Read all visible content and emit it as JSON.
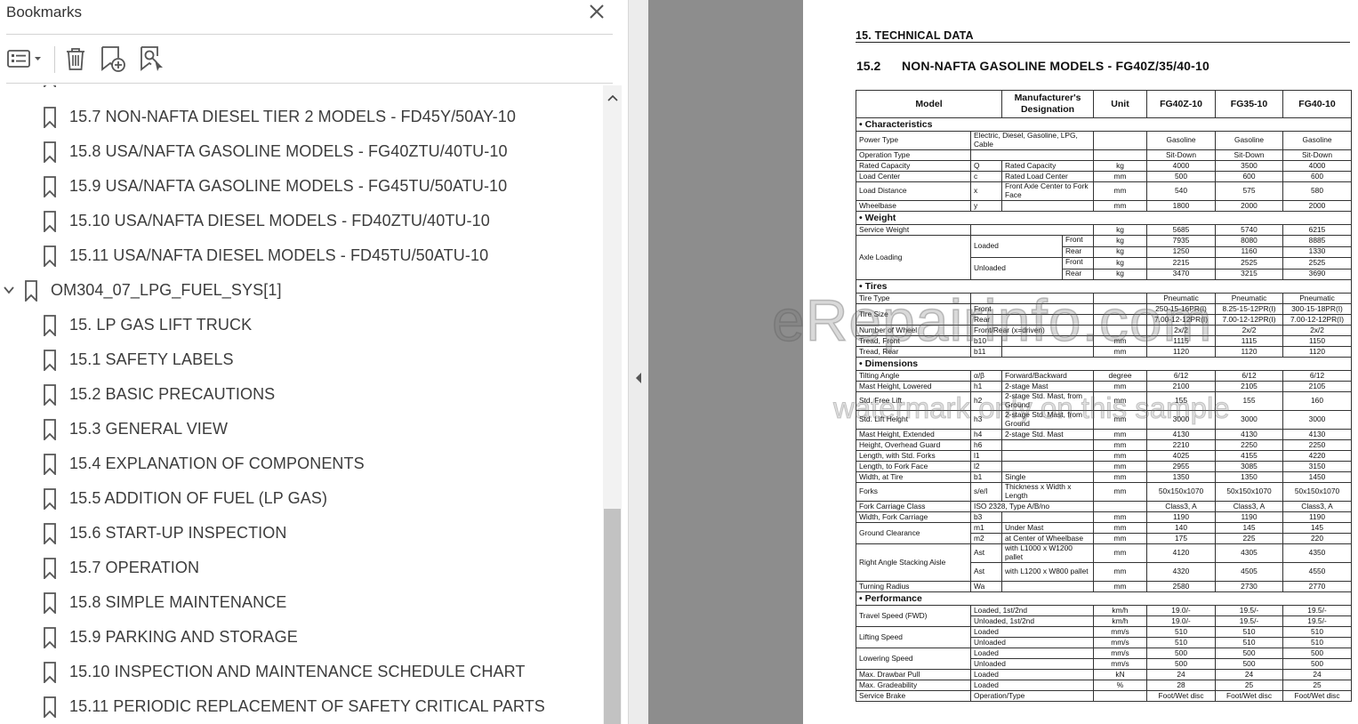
{
  "bookmarks_panel": {
    "title": "Bookmarks",
    "items": [
      {
        "label": "15.7 NON-NAFTA DIESEL TIER 2 MODELS - FD45Y/50AY-10"
      },
      {
        "label": "15.8 USA/NAFTA GASOLINE MODELS - FG40ZTU/40TU-10"
      },
      {
        "label": "15.9 USA/NAFTA GASOLINE MODELS - FG45TU/50ATU-10"
      },
      {
        "label": "15.10 USA/NAFTA DIESEL MODELS - FD40ZTU/40TU-10"
      },
      {
        "label": "15.11 USA/NAFTA DIESEL MODELS - FD45TU/50ATU-10"
      },
      {
        "label": "OM304_07_LPG_FUEL_SYS[1]"
      },
      {
        "label": "15. LP GAS LIFT TRUCK"
      },
      {
        "label": "15.1 SAFETY LABELS"
      },
      {
        "label": "15.2 BASIC PRECAUTIONS"
      },
      {
        "label": "15.3 GENERAL VIEW"
      },
      {
        "label": "15.4 EXPLANATION OF COMPONENTS"
      },
      {
        "label": "15.5 ADDITION OF FUEL (LP GAS)"
      },
      {
        "label": "15.6 START-UP INSPECTION"
      },
      {
        "label": "15.7 OPERATION"
      },
      {
        "label": "15.8 SIMPLE MAINTENANCE"
      },
      {
        "label": "15.9 PARKING AND STORAGE"
      },
      {
        "label": "15.10 INSPECTION AND MAINTENANCE SCHEDULE CHART"
      },
      {
        "label": "15.11 PERIODIC REPLACEMENT OF SAFETY CRITICAL PARTS"
      }
    ]
  },
  "document": {
    "section_title": "15. TECHNICAL DATA",
    "sub_number": "15.2",
    "sub_title": "NON-NAFTA GASOLINE MODELS - FG40Z/35/40-10",
    "headers": {
      "model": "Model",
      "designation": "Manufacturer's Designation",
      "unit": "Unit",
      "m1": "FG40Z-10",
      "m2": "FG35-10",
      "m3": "FG40-10"
    },
    "sections": {
      "characteristics": "• Characteristics",
      "weight": "• Weight",
      "tires": "• Tires",
      "dimensions": "• Dimensions",
      "performance": "• Performance"
    },
    "rows": {
      "power_type": {
        "name": "Power Type",
        "desc": "Electric, Diesel, Gasoline, LPG, Cable",
        "v": [
          "Gasoline",
          "Gasoline",
          "Gasoline"
        ]
      },
      "operation_type": {
        "name": "Operation Type",
        "v": [
          "Sit-Down",
          "Sit-Down",
          "Sit-Down"
        ]
      },
      "rated_capacity": {
        "name": "Rated Capacity",
        "sym": "Q",
        "desc": "Rated Capacity",
        "unit": "kg",
        "v": [
          "4000",
          "3500",
          "4000"
        ]
      },
      "load_center": {
        "name": "Load Center",
        "sym": "c",
        "desc": "Rated Load Center",
        "unit": "mm",
        "v": [
          "500",
          "600",
          "600"
        ]
      },
      "load_distance": {
        "name": "Load Distance",
        "sym": "x",
        "desc": "Front Axle Center to Fork Face",
        "unit": "mm",
        "v": [
          "540",
          "575",
          "580"
        ]
      },
      "wheelbase": {
        "name": "Wheelbase",
        "sym": "y",
        "unit": "mm",
        "v": [
          "1800",
          "2000",
          "2000"
        ]
      },
      "service_weight": {
        "name": "Service Weight",
        "unit": "kg",
        "v": [
          "5685",
          "5740",
          "6215"
        ]
      },
      "axle_loading": {
        "name": "Axle Loading",
        "loaded": "Loaded",
        "unloaded": "Unloaded",
        "front": "Front",
        "rear": "Rear",
        "unit": "kg",
        "loaded_front": [
          "7935",
          "8080",
          "8885"
        ],
        "loaded_rear": [
          "1250",
          "1160",
          "1330"
        ],
        "unloaded_front": [
          "2215",
          "2525",
          "2525"
        ],
        "unloaded_rear": [
          "3470",
          "3215",
          "3690"
        ]
      },
      "tire_type": {
        "name": "Tire Type",
        "v": [
          "Pneumatic",
          "Pneumatic",
          "Pneumatic"
        ]
      },
      "tire_size": {
        "name": "Tire Size",
        "front": "Front",
        "rear": "Rear",
        "front_v": [
          "250-15-16PR(I)",
          "8.25-15-12PR(I)",
          "300-15-18PR(I)"
        ],
        "rear_v": [
          "7.00-12-12PR(I)",
          "7.00-12-12PR(I)",
          "7.00-12-12PR(I)"
        ]
      },
      "number_of_wheel": {
        "name": "Number of Wheel",
        "desc": "Front/Rear (x=driven)",
        "v": [
          "2x/2",
          "2x/2",
          "2x/2"
        ]
      },
      "tread_front": {
        "name": "Tread, Front",
        "sym": "b10",
        "unit": "mm",
        "v": [
          "1115",
          "1115",
          "1150"
        ]
      },
      "tread_rear": {
        "name": "Tread, Rear",
        "sym": "b11",
        "unit": "mm",
        "v": [
          "1120",
          "1120",
          "1120"
        ]
      },
      "tilting_angle": {
        "name": "Tilting Angle",
        "sym": "α/β",
        "desc": "Forward/Backward",
        "unit": "degree",
        "v": [
          "6/12",
          "6/12",
          "6/12"
        ]
      },
      "mast_height_lowered": {
        "name": "Mast Height, Lowered",
        "sym": "h1",
        "desc": "2-stage Mast",
        "unit": "mm",
        "v": [
          "2100",
          "2105",
          "2105"
        ]
      },
      "std_free_lift": {
        "name": "Std. Free Lift",
        "sym": "h2",
        "desc": "2-stage Std. Mast, from Ground",
        "unit": "mm",
        "v": [
          "155",
          "155",
          "160"
        ]
      },
      "std_lift_height": {
        "name": "Std. Lift Height",
        "sym": "h3",
        "desc": "2-stage Std. Mast, from Ground",
        "unit": "mm",
        "v": [
          "3000",
          "3000",
          "3000"
        ]
      },
      "mast_height_extended": {
        "name": "Mast Height, Extended",
        "sym": "h4",
        "desc": "2-stage Std. Mast",
        "unit": "mm",
        "v": [
          "4130",
          "4130",
          "4130"
        ]
      },
      "height_overhead_guard": {
        "name": "Height, Overhead Guard",
        "sym": "h6",
        "unit": "mm",
        "v": [
          "2210",
          "2250",
          "2250"
        ]
      },
      "length_std_forks": {
        "name": "Length, with Std. Forks",
        "sym": "l1",
        "unit": "mm",
        "v": [
          "4025",
          "4155",
          "4220"
        ]
      },
      "length_fork_face": {
        "name": "Length, to Fork Face",
        "sym": "l2",
        "unit": "mm",
        "v": [
          "2955",
          "3085",
          "3150"
        ]
      },
      "width_at_tire": {
        "name": "Width, at Tire",
        "sym": "b1",
        "desc": "Single",
        "unit": "mm",
        "v": [
          "1350",
          "1350",
          "1450"
        ]
      },
      "forks": {
        "name": "Forks",
        "sym": "s/e/l",
        "desc": "Thickness x Width x Length",
        "unit": "mm",
        "v": [
          "50x150x1070",
          "50x150x1070",
          "50x150x1070"
        ]
      },
      "fork_carriage_class": {
        "name": "Fork Carriage Class",
        "desc": "ISO 2328, Type A/B/no",
        "v": [
          "Class3, A",
          "Class3, A",
          "Class3, A"
        ]
      },
      "width_fork_carriage": {
        "name": "Width, Fork Carriage",
        "sym": "b3",
        "unit": "mm",
        "v": [
          "1190",
          "1190",
          "1190"
        ]
      },
      "ground_clearance": {
        "name": "Ground Clearance",
        "sym1": "m1",
        "desc1": "Under Mast",
        "v1": [
          "140",
          "145",
          "145"
        ],
        "sym2": "m2",
        "desc2": "at Center of Wheelbase",
        "v2": [
          "175",
          "225",
          "220"
        ],
        "unit": "mm"
      },
      "stacking_aisle": {
        "name": "Right Angle Stacking Aisle",
        "sym": "Ast",
        "desc1": "with L1000 x W1200 pallet",
        "v1": [
          "4120",
          "4305",
          "4350"
        ],
        "desc2": "with L1200 x W800 pallet",
        "v2": [
          "4320",
          "4505",
          "4550"
        ],
        "unit": "mm"
      },
      "turning_radius": {
        "name": "Turning Radius",
        "sym": "Wa",
        "unit": "mm",
        "v": [
          "2580",
          "2730",
          "2770"
        ]
      },
      "travel_speed": {
        "name": "Travel Speed (FWD)",
        "d1": "Loaded, 1st/2nd",
        "d2": "Unloaded, 1st/2nd",
        "unit": "km/h",
        "v1": [
          "19.0/-",
          "19.5/-",
          "19.5/-"
        ],
        "v2": [
          "19.0/-",
          "19.5/-",
          "19.5/-"
        ]
      },
      "lifting_speed": {
        "name": "Lifting Speed",
        "d1": "Loaded",
        "d2": "Unloaded",
        "unit": "mm/s",
        "v1": [
          "510",
          "510",
          "510"
        ],
        "v2": [
          "510",
          "510",
          "510"
        ]
      },
      "lowering_speed": {
        "name": "Lowering Speed",
        "d1": "Loaded",
        "d2": "Unloaded",
        "unit": "mm/s",
        "v1": [
          "500",
          "500",
          "500"
        ],
        "v2": [
          "500",
          "500",
          "500"
        ]
      },
      "max_drawbar": {
        "name": "Max. Drawbar Pull",
        "desc": "Loaded",
        "unit": "kN",
        "v": [
          "24",
          "24",
          "24"
        ]
      },
      "max_gradeability": {
        "name": "Max. Gradeability",
        "desc": "Loaded",
        "unit": "%",
        "v": [
          "28",
          "25",
          "25"
        ]
      },
      "service_brake": {
        "name": "Service Brake",
        "desc": "Operation/Type",
        "v": [
          "Foot/Wet disc",
          "Foot/Wet disc",
          "Foot/Wet disc"
        ]
      }
    },
    "watermark_main": "eRepairinfo.com",
    "watermark_sub": "watermark only on this sample"
  },
  "colors": {
    "doc_background": "#8d8d8d",
    "panel_background": "#ffffff",
    "scroll_thumb": "#c2c2c2"
  }
}
